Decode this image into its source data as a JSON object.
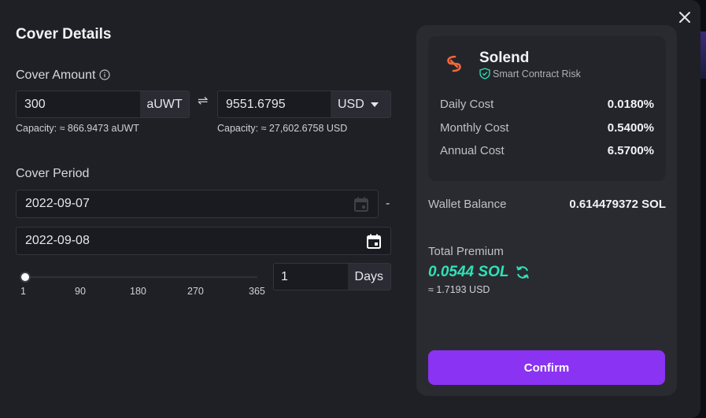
{
  "modal": {
    "title": "Cover Details",
    "close_icon": "close-icon"
  },
  "cover_amount": {
    "label": "Cover Amount",
    "token_value": "300",
    "token_unit": "aUWT",
    "token_capacity": "Capacity: ≈ 866.9473 aUWT",
    "swap_glyph": "⇌",
    "usd_value": "9551.6795",
    "usd_unit": "USD",
    "usd_capacity": "Capacity: ≈ 27,602.6758 USD"
  },
  "cover_period": {
    "label": "Cover Period",
    "start_date": "2022-09-07",
    "separator": "-",
    "end_date": "2022-09-08",
    "slider": {
      "min": 1,
      "max": 365,
      "value": 1
    },
    "ticks": [
      "1",
      "90",
      "180",
      "270",
      "365"
    ],
    "days_value": "1",
    "days_unit": "Days"
  },
  "summary": {
    "protocol_name": "Solend",
    "risk_type": "Smart Contract Risk",
    "costs": [
      {
        "label": "Daily Cost",
        "value": "0.0180%"
      },
      {
        "label": "Monthly Cost",
        "value": "0.5400%"
      },
      {
        "label": "Annual Cost",
        "value": "6.5700%"
      }
    ],
    "wallet_label": "Wallet Balance",
    "wallet_value": "0.614479372 SOL",
    "premium_label": "Total Premium",
    "premium_value": "0.0544 SOL",
    "premium_usd": "≈ 1.7193 USD",
    "confirm_label": "Confirm"
  },
  "colors": {
    "accent": "#8b33f2",
    "premium": "#2fe2b7",
    "logo": "#f2673a",
    "shield": "#2fe2b7"
  }
}
